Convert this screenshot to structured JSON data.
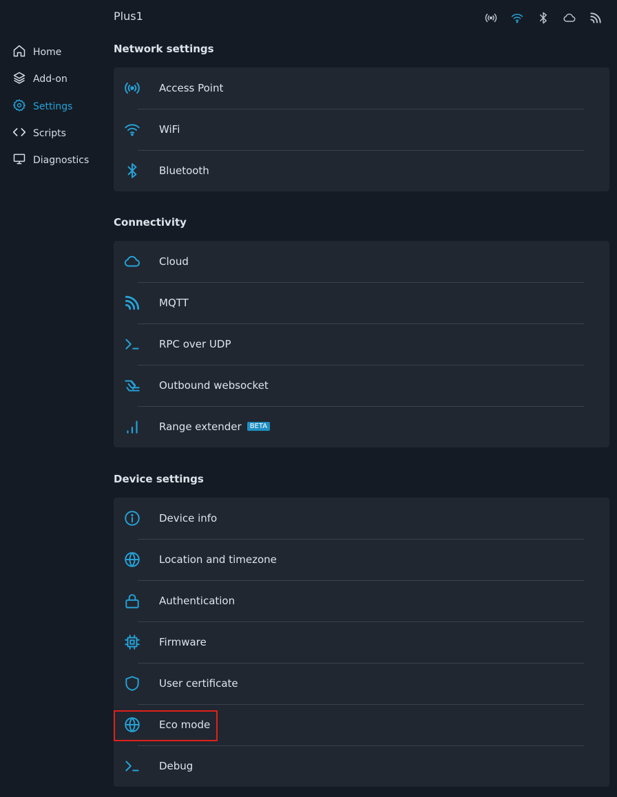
{
  "header": {
    "device_name": "Plus1"
  },
  "status_icons": [
    "access-point-icon",
    "wifi-icon",
    "bluetooth-icon",
    "cloud-icon",
    "mqtt-icon"
  ],
  "sidebar": {
    "items": [
      {
        "label": "Home",
        "icon": "home-icon"
      },
      {
        "label": "Add-on",
        "icon": "layers-icon"
      },
      {
        "label": "Settings",
        "icon": "gear-icon",
        "active": true
      },
      {
        "label": "Scripts",
        "icon": "code-icon"
      },
      {
        "label": "Diagnostics",
        "icon": "monitor-icon"
      }
    ]
  },
  "sections": [
    {
      "title": "Network settings",
      "items": [
        {
          "label": "Access Point",
          "icon": "access-point-icon"
        },
        {
          "label": "WiFi",
          "icon": "wifi-icon"
        },
        {
          "label": "Bluetooth",
          "icon": "bluetooth-icon"
        }
      ]
    },
    {
      "title": "Connectivity",
      "items": [
        {
          "label": "Cloud",
          "icon": "cloud-icon"
        },
        {
          "label": "MQTT",
          "icon": "mqtt-icon"
        },
        {
          "label": "RPC over UDP",
          "icon": "terminal-icon"
        },
        {
          "label": "Outbound websocket",
          "icon": "websocket-icon"
        },
        {
          "label": "Range extender",
          "icon": "signal-bars-icon",
          "badge": "BETA"
        }
      ]
    },
    {
      "title": "Device settings",
      "items": [
        {
          "label": "Device info",
          "icon": "info-icon"
        },
        {
          "label": "Location and timezone",
          "icon": "globe-icon"
        },
        {
          "label": "Authentication",
          "icon": "lock-icon"
        },
        {
          "label": "Firmware",
          "icon": "chip-icon"
        },
        {
          "label": "User certificate",
          "icon": "shield-icon"
        },
        {
          "label": "Eco mode",
          "icon": "globe-icon"
        },
        {
          "label": "Debug",
          "icon": "terminal-icon"
        }
      ]
    }
  ],
  "colors": {
    "accent": "#25a3d9",
    "background": "#141b24",
    "card": "#202731",
    "highlight": "#e0201a"
  }
}
